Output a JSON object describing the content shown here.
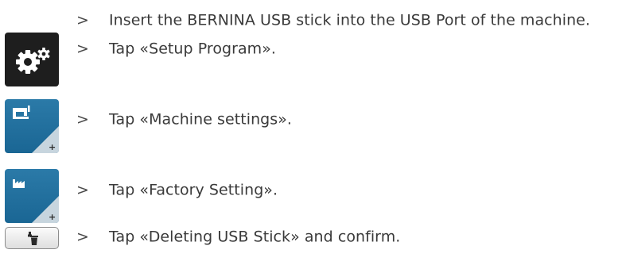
{
  "steps": [
    {
      "marker": ">",
      "text": "Insert the BERNINA USB stick into the USB Port of the machine."
    },
    {
      "marker": ">",
      "text": "Tap «Setup Program»."
    },
    {
      "marker": ">",
      "text": "Tap «Machine settings»."
    },
    {
      "marker": ">",
      "text": "Tap «Factory Setting»."
    },
    {
      "marker": ">",
      "text": "Tap «Deleting USB Stick» and confirm."
    }
  ],
  "icons": {
    "setup": "gears-icon",
    "machine_settings": "sewing-machine-icon",
    "factory_setting": "factory-icon",
    "delete_usb": "usb-stick-delete-icon"
  },
  "colors": {
    "setup_bg": "#1e1e1e",
    "settings_blue": "#1f6e9c",
    "text": "#3a3a3a"
  }
}
